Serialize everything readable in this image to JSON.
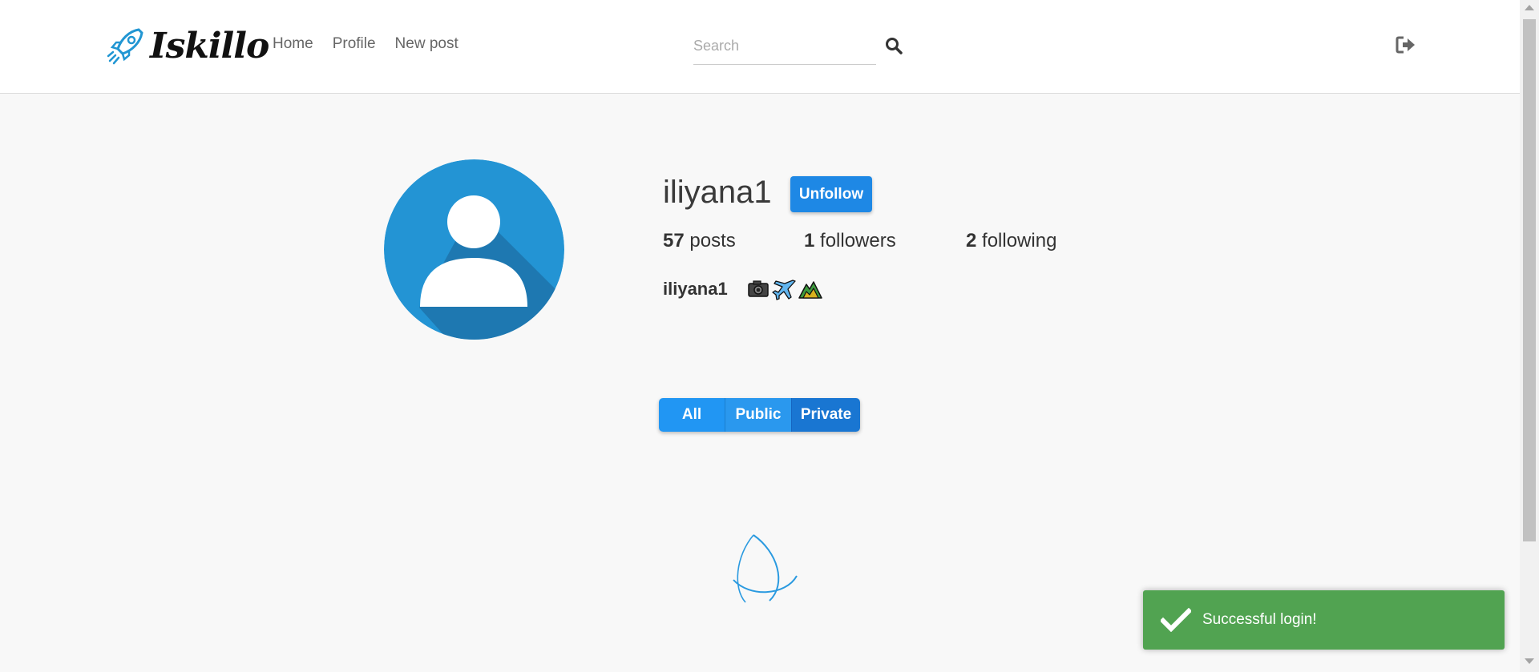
{
  "app": {
    "brand": "Iskillo",
    "accent": "#1e88e5"
  },
  "nav": {
    "links": [
      "Home",
      "Profile",
      "New post"
    ]
  },
  "search": {
    "placeholder": "Search",
    "value": ""
  },
  "profile": {
    "username": "iliyana1",
    "follow_label": "Unfollow",
    "stats": [
      {
        "count": "57",
        "label": "posts"
      },
      {
        "count": "1",
        "label": "followers"
      },
      {
        "count": "2",
        "label": "following"
      }
    ],
    "bio_name": "iliyana1",
    "bio_icons": [
      "camera-emoji",
      "airplane-emoji",
      "mountain-emoji"
    ]
  },
  "filters": {
    "all": "All",
    "public": "Public",
    "private": "Private",
    "selected": "Private"
  },
  "toast": {
    "message": "Successful login!",
    "color": "#51a351"
  }
}
